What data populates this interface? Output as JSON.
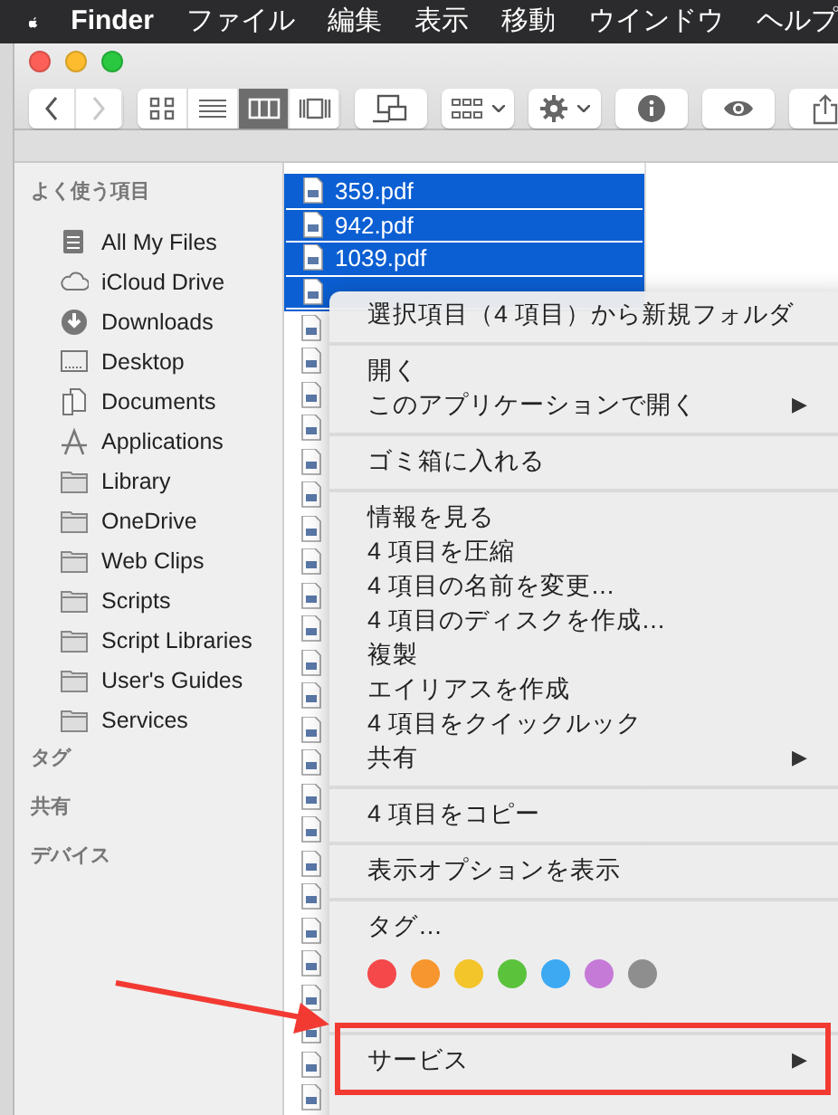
{
  "menu_bar": {
    "app_name": "Finder",
    "menus": [
      "ファイル",
      "編集",
      "表示",
      "移動",
      "ウインドウ",
      "ヘルプ"
    ]
  },
  "toolbar": {
    "nav": [
      {
        "kind": "back",
        "disabled": false
      },
      {
        "kind": "forward",
        "disabled": true
      }
    ],
    "view_modes": [
      {
        "kind": "icons",
        "selected": false
      },
      {
        "kind": "list",
        "selected": false
      },
      {
        "kind": "columns",
        "selected": true
      },
      {
        "kind": "coverflow",
        "selected": false
      }
    ],
    "buttons": [
      {
        "kind": "arrange"
      },
      {
        "kind": "group"
      },
      {
        "kind": "gear"
      },
      {
        "kind": "info"
      },
      {
        "kind": "eye"
      },
      {
        "kind": "share"
      }
    ]
  },
  "sidebar": [
    {
      "title": "よく使う項目",
      "items": [
        {
          "label": "All My Files",
          "kind": "allfiles"
        },
        {
          "label": "iCloud Drive",
          "kind": "cloud"
        },
        {
          "label": "Downloads",
          "kind": "download"
        },
        {
          "label": "Desktop",
          "kind": "desktop"
        },
        {
          "label": "Documents",
          "kind": "documents"
        },
        {
          "label": "Applications",
          "kind": "apps"
        },
        {
          "label": "Library",
          "kind": "folder"
        },
        {
          "label": "OneDrive",
          "kind": "folder"
        },
        {
          "label": "Web Clips",
          "kind": "folder"
        },
        {
          "label": "Scripts",
          "kind": "folder"
        },
        {
          "label": "Script Libraries",
          "kind": "folder"
        },
        {
          "label": "User's Guides",
          "kind": "folder"
        },
        {
          "label": "Services",
          "kind": "folder"
        }
      ]
    },
    {
      "title": "タグ"
    },
    {
      "title": "共有"
    },
    {
      "title": "デバイス"
    }
  ],
  "files": [
    {
      "name": "359.pdf",
      "selected": true
    },
    {
      "name": "942.pdf",
      "selected": true
    },
    {
      "name": "1039.pdf",
      "selected": true
    },
    {
      "selected": true
    },
    {
      "selected": false
    },
    {
      "selected": false
    },
    {
      "selected": false
    },
    {
      "selected": false
    },
    {
      "selected": false
    },
    {
      "selected": false
    },
    {
      "selected": false
    },
    {
      "selected": false
    },
    {
      "selected": false
    },
    {
      "selected": false
    },
    {
      "selected": false
    },
    {
      "selected": false
    },
    {
      "selected": false
    },
    {
      "selected": false
    },
    {
      "selected": false
    },
    {
      "selected": false
    },
    {
      "selected": false
    },
    {
      "selected": false
    },
    {
      "selected": false
    },
    {
      "selected": false
    },
    {
      "selected": false
    },
    {
      "selected": false
    },
    {
      "selected": false
    },
    {
      "selected": false
    }
  ],
  "context_menu": {
    "groups": [
      [
        {
          "label": "選択項目（4 項目）から新規フォルダ",
          "submenu": false
        }
      ],
      [
        {
          "label": "開く",
          "submenu": false
        },
        {
          "label": "このアプリケーションで開く",
          "submenu": true
        }
      ],
      [
        {
          "label": "ゴミ箱に入れる",
          "submenu": false
        }
      ],
      [
        {
          "label": "情報を見る",
          "submenu": false
        },
        {
          "label": "4 項目を圧縮",
          "submenu": false
        },
        {
          "label": "4 項目の名前を変更…",
          "submenu": false
        },
        {
          "label": "4 項目のディスクを作成…",
          "submenu": false
        },
        {
          "label": "複製",
          "submenu": false
        },
        {
          "label": "エイリアスを作成",
          "submenu": false
        },
        {
          "label": "4 項目をクイックルック",
          "submenu": false
        },
        {
          "label": "共有",
          "submenu": true
        }
      ],
      [
        {
          "label": "4 項目をコピー",
          "submenu": false
        }
      ],
      [
        {
          "label": "表示オプションを表示",
          "submenu": false
        }
      ],
      [
        {
          "label": "タグ…",
          "submenu": false
        }
      ],
      [
        {
          "label": "サービス",
          "submenu": true,
          "highlighted": true
        }
      ]
    ],
    "tags": [
      {
        "color": "#f4484a"
      },
      {
        "color": "#f7962e"
      },
      {
        "color": "#f4c42b"
      },
      {
        "color": "#5ac23b"
      },
      {
        "color": "#3da9f3"
      },
      {
        "color": "#c57ad8"
      },
      {
        "color": "#8e8e8e"
      }
    ],
    "submenu_marker": "▶"
  }
}
